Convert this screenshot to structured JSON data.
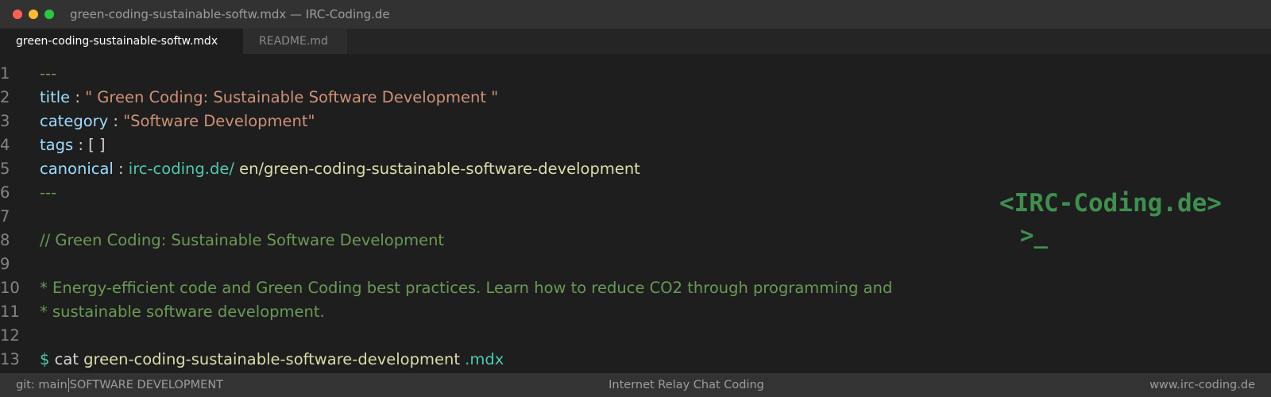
{
  "window": {
    "title": "green-coding-sustainable-softw.mdx — IRC-Coding.de"
  },
  "tabs": [
    {
      "label": "green-coding-sustainable-softw.mdx",
      "active": true
    },
    {
      "label": "README.md",
      "active": false
    }
  ],
  "editor": {
    "lines": [
      {
        "num": "1",
        "dashes": "---"
      },
      {
        "num": "2",
        "key": "title",
        "sep": " : ",
        "value": "\" Green Coding: Sustainable Software Development \""
      },
      {
        "num": "3",
        "key": "category",
        "sep": " : ",
        "value": "\"Software Development\""
      },
      {
        "num": "4",
        "key": "tags",
        "sep": " : ",
        "value": "[ ]"
      },
      {
        "num": "5",
        "key": "canonical",
        "sep": " : ",
        "domain": "irc-coding.de/",
        "path": " en/green-coding-sustainable-software-development"
      },
      {
        "num": "6",
        "dashes": "---"
      },
      {
        "num": "7"
      },
      {
        "num": "8",
        "comment": "// Green Coding: Sustainable Software Development"
      },
      {
        "num": "9"
      },
      {
        "num": "10",
        "comment": "* Energy-efficient code and Green Coding best practices. Learn how to reduce CO2 through programming and"
      },
      {
        "num": "11",
        "comment": "* sustainable software development."
      },
      {
        "num": "12"
      },
      {
        "num": "13",
        "prompt": "$",
        "cmd": " cat ",
        "file": "green-coding-sustainable-software-development",
        "ext": " .mdx"
      }
    ]
  },
  "logo": {
    "text": "<IRC-Coding.de>",
    "cursor": ">_"
  },
  "statusbar": {
    "branch": "git: main",
    "category": "SOFTWARE DEVELOPMENT",
    "center": "Internet Relay Chat Coding",
    "right": "www.irc-coding.de"
  },
  "colors": {
    "accent_green": "#3f8f4f",
    "key": "#9cdcfe",
    "string": "#ce9178",
    "comment": "#6a9955",
    "link": "#4ec9b0"
  }
}
